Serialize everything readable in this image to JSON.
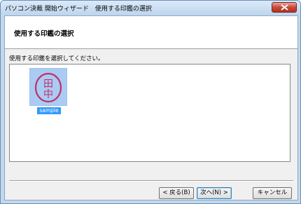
{
  "window": {
    "title": "パソコン決裁 開始ウィザード　使用する印鑑の選択"
  },
  "header": {
    "title": "使用する印鑑の選択"
  },
  "content": {
    "prompt": "使用する印鑑を選択してください。",
    "seals": [
      {
        "label": "sample",
        "glyphs": [
          "田",
          "中"
        ],
        "selected": true
      }
    ]
  },
  "buttons": {
    "back": "< 戻る(B)",
    "next": "次へ(N) >",
    "cancel": "キャンセル"
  },
  "colors": {
    "selection": "#3399ff",
    "seal_ink": "#c0306a"
  }
}
